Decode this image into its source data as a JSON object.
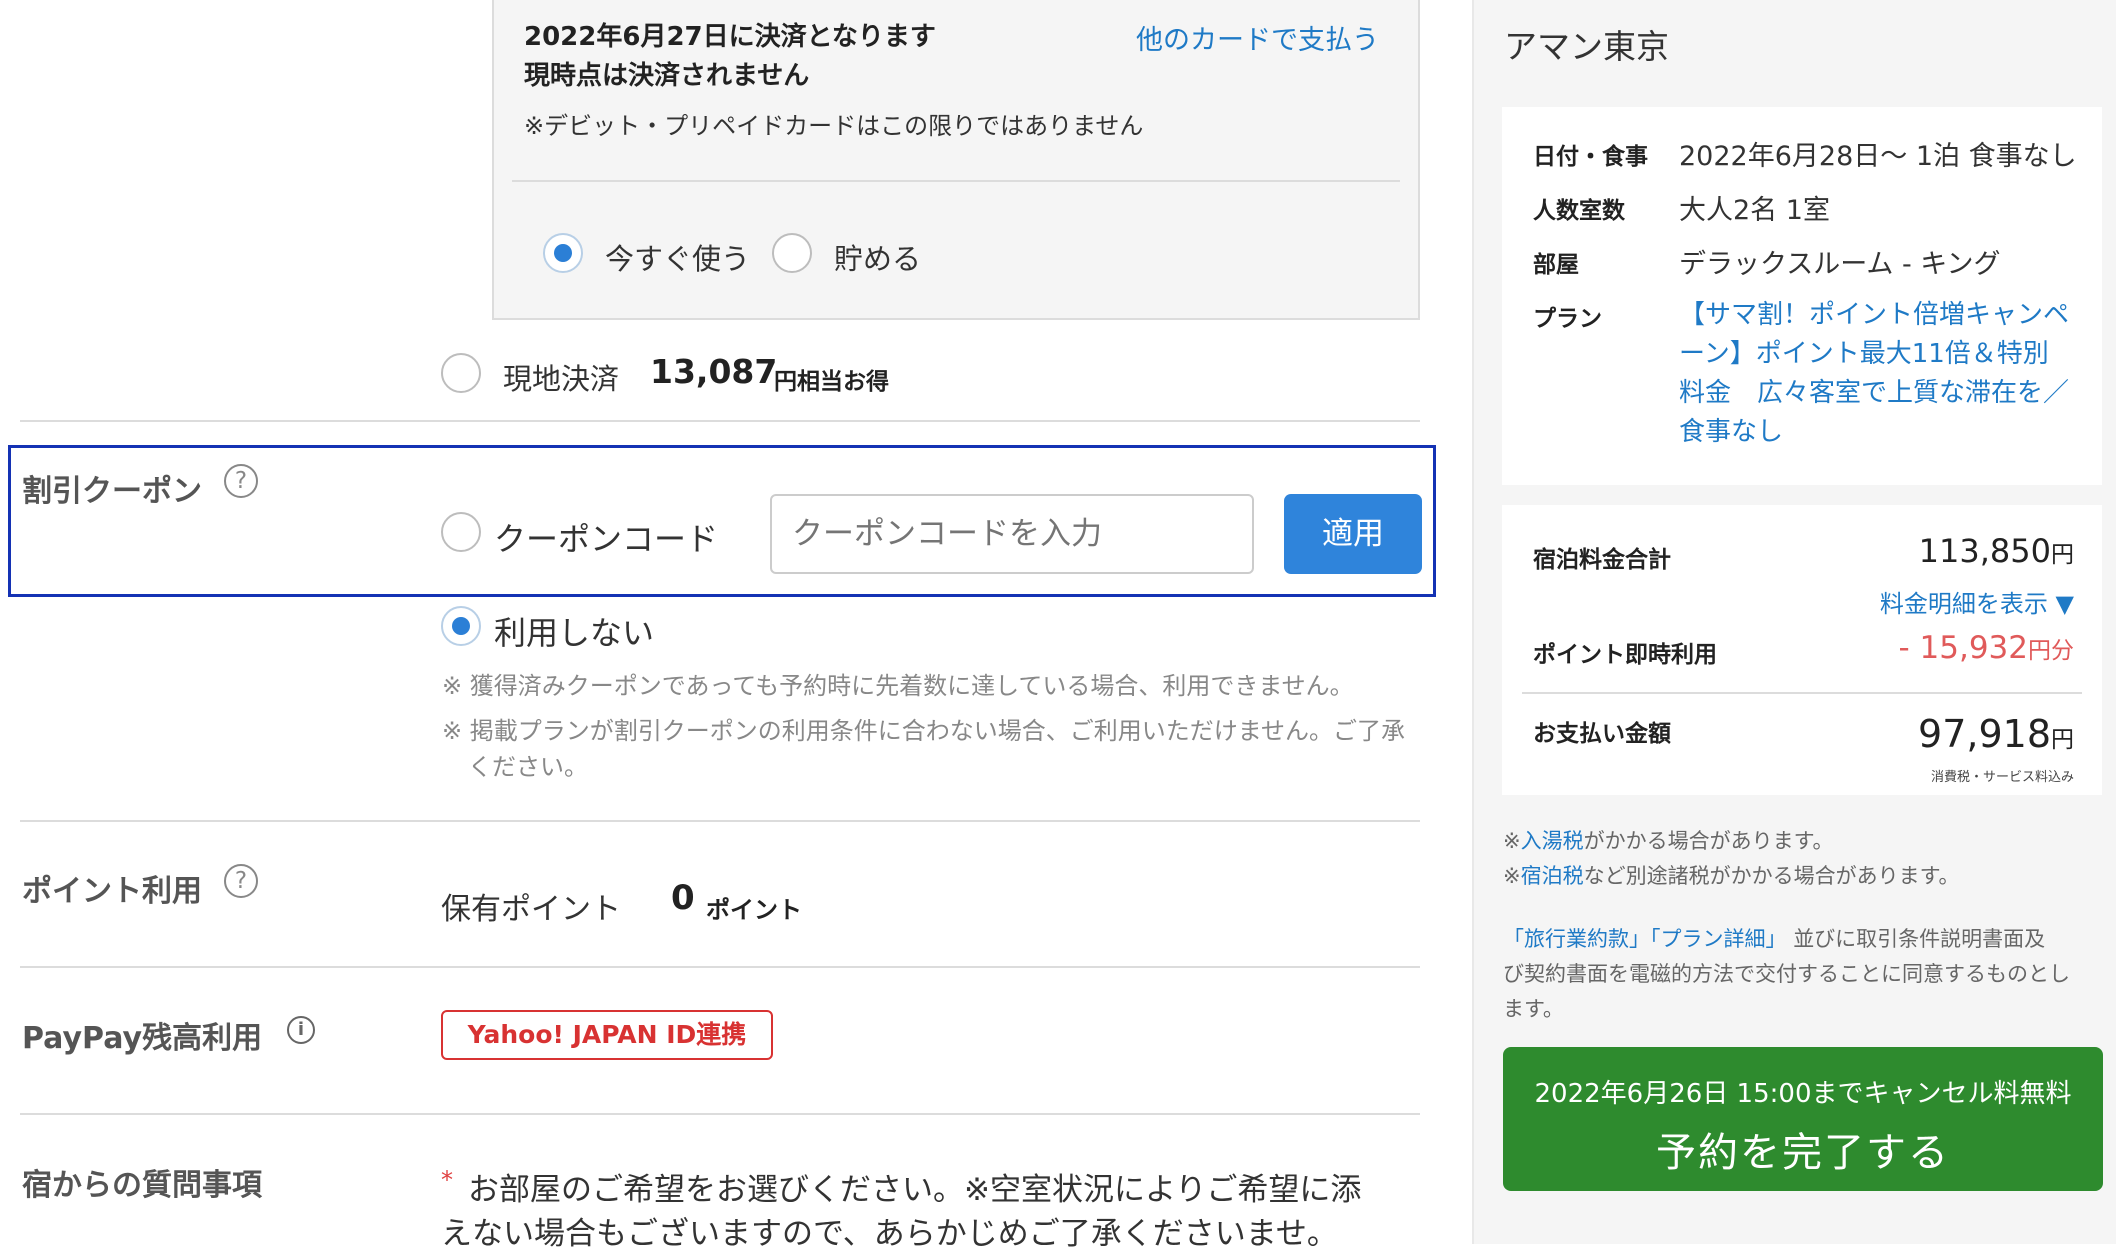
{
  "card_payment": {
    "date_line": "2022年6月27日に決済となります",
    "not_charged_line": "現時点は決済されません",
    "other_card_link": "他のカードで支払う",
    "note": "※デビット・プリペイドカードはこの限りではありません",
    "point_options": [
      "今すぐ使う",
      "貯める"
    ]
  },
  "onsite_payment": {
    "label": "現地決済",
    "amount": "13,087",
    "suffix": "円相当お得"
  },
  "coupon": {
    "section_title": "割引クーポン",
    "help_icon": "question-circle-icon",
    "code_option_label": "クーポンコード",
    "input_placeholder": "クーポンコードを入力",
    "apply_button": "適用",
    "no_use_label": "利用しない",
    "note1": "※ 獲得済みクーポンであっても予約時に先着数に達している場合、利用できません。",
    "note2a": "※ 掲載プランが割引クーポンの利用条件に合わない場合、ご利用いただけません。ご了承",
    "note2b": "ください。"
  },
  "points": {
    "section_title": "ポイント利用",
    "held_label": "保有ポイント",
    "value": "0",
    "unit": "ポイント"
  },
  "paypay": {
    "section_title": "PayPay残高利用",
    "info_icon": "info-circle-icon",
    "link_button": "Yahoo! JAPAN ID連携"
  },
  "questions": {
    "section_title": "宿からの質問事項",
    "required_mark": "*",
    "line1": "お部屋のご希望をお選びください。※空室状況によりご希望に添",
    "line2": "えない場合もございますので、あらかじめご了承くださいませ。"
  },
  "summary": {
    "hotel_name": "アマン東京",
    "rows": [
      {
        "label": "日付・食事",
        "value": "2022年6月28日〜 1泊 食事なし"
      },
      {
        "label": "人数室数",
        "value": "大人2名 1室"
      },
      {
        "label": "部屋",
        "value": "デラックスルーム - キング"
      }
    ],
    "plan_label": "プラン",
    "plan_lines": [
      "【サマ割！ポイント倍増キャンペ",
      "ーン】ポイント最大11倍＆特別",
      "料金　広々客室で上質な滞在を／",
      "食事なし"
    ],
    "total_label": "宿泊料金合計",
    "total_value": "113,850",
    "yen": "円",
    "breakdown_link": "料金明細を表示 ▼",
    "point_use_label": "ポイント即時利用",
    "point_use_value": "- 15,932",
    "point_use_unit": "円分",
    "pay_label": "お支払い金額",
    "pay_value": "97,918",
    "tax_note": "消費税・サービス料込み",
    "bath_tax_link": "入湯税",
    "bath_tax_rest": "がかかる場合があります。",
    "stay_tax_link": "宿泊税",
    "stay_tax_rest": "など別途諸税がかかる場合があります。",
    "note_prefix": "※",
    "terms_link": "「旅行業約款」",
    "plan_detail_link": "「プラン詳細」",
    "terms_rest1": "並びに取引条件説明書面及",
    "terms_rest2": "び契約書面を電磁的方法で交付することに同意するものとし",
    "terms_rest3": "ます。",
    "cancel_note": "2022年6月26日 15:00までキャンセル料無料",
    "submit_button": "予約を完了する"
  },
  "colors": {
    "accent_blue": "#2b7fd6",
    "link_blue": "#1f7ac6",
    "highlight_border": "#1432b4",
    "submit_green": "#2e8b2e",
    "discount_red": "#e05a5a",
    "paypay_red": "#d83232"
  }
}
